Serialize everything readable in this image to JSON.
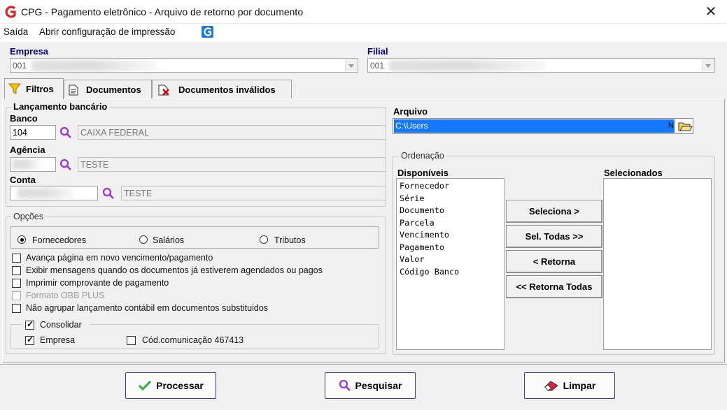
{
  "window": {
    "title": "CPG - Pagamento eletrônico - Arquivo de retorno por documento"
  },
  "menu": {
    "items": [
      "Saída",
      "Abrir configuração de impressão"
    ]
  },
  "empresa": {
    "label": "Empresa",
    "value": "001"
  },
  "filial": {
    "label": "Filial",
    "value": "001"
  },
  "tabs": [
    {
      "label": "Filtros",
      "icon": "filter-icon",
      "active": true
    },
    {
      "label": "Documentos",
      "icon": "document-icon",
      "active": false
    },
    {
      "label": "Documentos inválidos",
      "icon": "invalid-document-icon",
      "active": false
    }
  ],
  "lancamento": {
    "title": "Lançamento bancário",
    "banco": {
      "label": "Banco",
      "code": "104",
      "name": "CAIXA FEDERAL"
    },
    "agencia": {
      "label": "Agência",
      "code": "",
      "name": "TESTE"
    },
    "conta": {
      "label": "Conta",
      "code": "",
      "name": "TESTE"
    }
  },
  "opcoes": {
    "title": "Opções",
    "radios": [
      {
        "label": "Fornecedores",
        "selected": true
      },
      {
        "label": "Salários",
        "selected": false
      },
      {
        "label": "Tributos",
        "selected": false
      }
    ],
    "checks": [
      {
        "label": "Avança página em novo vencimento/pagamento",
        "checked": false,
        "enabled": true
      },
      {
        "label": "Exibir mensagens quando os documentos já estiverem agendados ou pagos",
        "checked": false,
        "enabled": true
      },
      {
        "label": "Imprimir comprovante de pagamento",
        "checked": false,
        "enabled": true
      },
      {
        "label": "Formato OBB PLUS",
        "checked": false,
        "enabled": false
      },
      {
        "label": "Não agrupar lançamento contábil em documentos substituidos",
        "checked": false,
        "enabled": true
      }
    ],
    "consolidar": {
      "label": "Consolidar",
      "checked": true,
      "empresa": {
        "label": "Empresa",
        "checked": true
      },
      "cod": {
        "label": "Cód.comunicação 467413",
        "checked": false
      }
    }
  },
  "arquivo": {
    "label": "Arquivo",
    "value": "C:\\Users",
    "tail": "N"
  },
  "ordenacao": {
    "title": "Ordenação",
    "disponiveis_label": "Disponíveis",
    "selecionados_label": "Selecionados",
    "disponiveis": [
      "Fornecedor",
      "Série",
      "Documento",
      "Parcela",
      "Vencimento",
      "Pagamento",
      "Valor",
      "Código Banco"
    ],
    "selecionados": [],
    "buttons": [
      "Seleciona >",
      "Sel. Todas >>",
      "< Retorna",
      "<< Retorna Todas"
    ]
  },
  "footer": {
    "processar": "Processar",
    "pesquisar": "Pesquisar",
    "limpar": "Limpar"
  },
  "colors": {
    "label_blue": "#000080",
    "selection_blue": "#1478ff",
    "brand_red": "#d8232a",
    "search_purple": "#9b30d9"
  }
}
